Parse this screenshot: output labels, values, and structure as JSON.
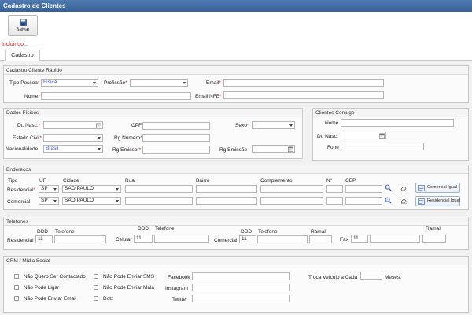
{
  "window": {
    "title": "Cadastro de Clientes"
  },
  "toolbar": {
    "save_label": "Salvar"
  },
  "status": "Incluindo...",
  "tabs": [
    {
      "label": "Cadastro"
    }
  ],
  "quick": {
    "title": "Cadastro Cliente Rápido",
    "tipo_pessoa_label": "Tipo Pessoa",
    "tipo_pessoa_value": "Física",
    "profissao_label": "Profissão",
    "email_label": "Email",
    "nome_label": "Nome",
    "email_nfe_label": "Email NFE"
  },
  "fisicos": {
    "title": "Dados Físicos",
    "dt_nasc_label": "Dt. Nasc.",
    "cpf_label": "CPF",
    "sexo_label": "Sexo",
    "estado_civil_label": "Estado Civil",
    "rg_numero_label": "Rg Número",
    "nacionalidade_label": "Nacionalidade",
    "nacionalidade_value": "Brasil",
    "rg_emissor_label": "Rg Emissor",
    "rg_emissao_label": "Rg Emissão"
  },
  "conjuge": {
    "title": "Clientes Conjuge",
    "nome_label": "Nome",
    "dt_nasc_label": "Dt. Nasc.",
    "fone_label": "Fone"
  },
  "enderecos": {
    "title": "Endereços",
    "headers": {
      "tipo": "Tipo",
      "uf": "UF",
      "cidade": "Cidade",
      "rua": "Rua",
      "bairro": "Bairro",
      "complemento": "Complemento",
      "numero": "Nº",
      "cep": "CEP"
    },
    "rows": [
      {
        "tipo": "Residencial",
        "uf": "SP",
        "cidade": "SAO PAULO",
        "button": "Comercial Igual"
      },
      {
        "tipo": "Comercial",
        "uf": "SP",
        "cidade": "SAO PAULO",
        "button": "Residencial Igual"
      }
    ]
  },
  "telefones": {
    "title": "Telefones",
    "ddd": "DDD",
    "telefone": "Telefone",
    "ramal": "Ramal",
    "residencial_label": "Residencial",
    "residencial_ddd": "11",
    "celular_label": "Celular",
    "celular_ddd": "11",
    "comercial_label": "Comercial",
    "comercial_ddd": "11",
    "fax_label": "Fax",
    "fax_ddd": "11"
  },
  "crm": {
    "title": "CRM / Mídia Social",
    "checks_col1": [
      "Não Quero Ser Contactado",
      "Não Pode Ligar",
      "Não Pode Enviar Email"
    ],
    "checks_col2": [
      "Não Pode Enviar SMS",
      "Não Pode Enviar Mala",
      "Dotz"
    ],
    "facebook_label": "Facebook",
    "instagram_label": "Instagram",
    "twitter_label": "Twitter",
    "troca_label": "Troca Veículo a Cada",
    "meses_label": "Meses."
  }
}
